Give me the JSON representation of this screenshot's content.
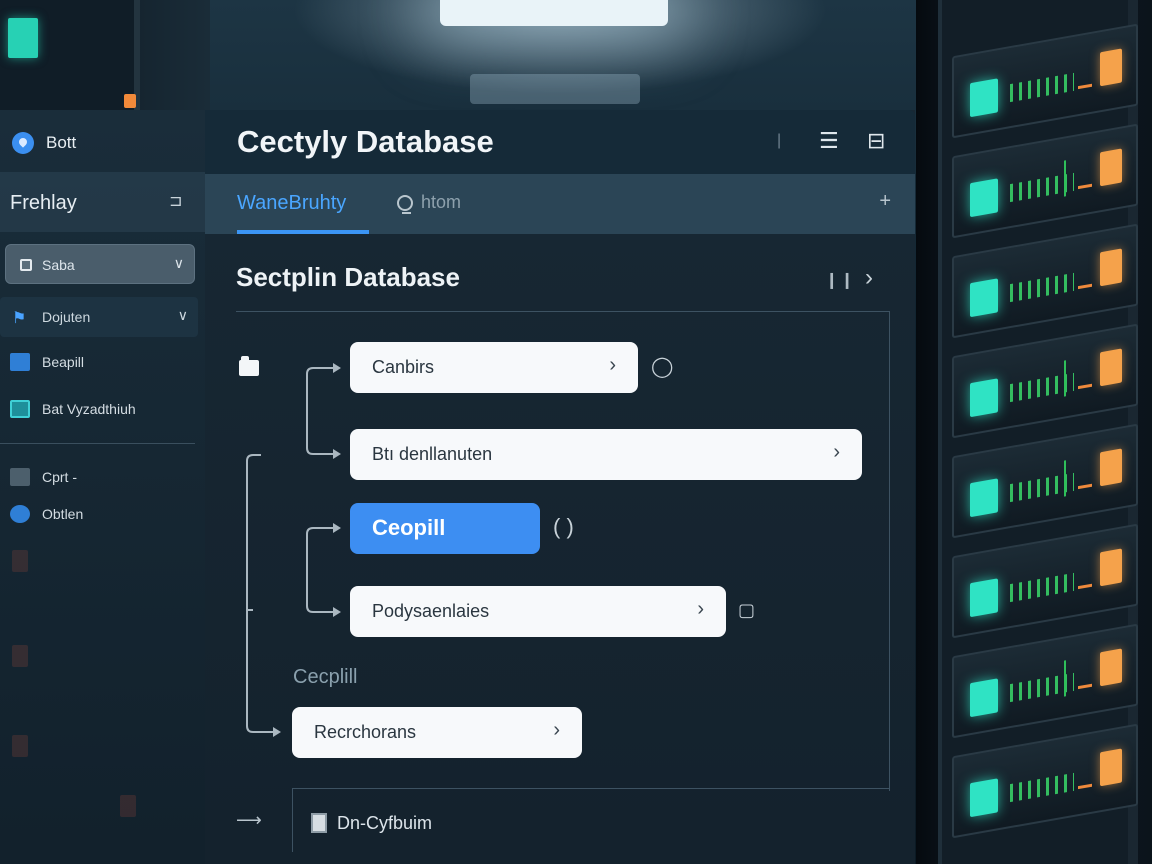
{
  "colors": {
    "accent": "#3d8ef2",
    "tab_active": "#4aa6ff",
    "panel": "#182834",
    "led_teal": "#2fe3c4",
    "led_orange": "#f5a24b"
  },
  "sidebar": {
    "brand": "Bott",
    "header": {
      "title": "Frehlay",
      "icon": "collapse-icon"
    },
    "select": {
      "label": "Saba"
    },
    "group": {
      "label": "Dojuten"
    },
    "items": [
      {
        "label": "Beapill",
        "icon": "blue-square-icon"
      },
      {
        "label": "Bat Vyzadthiuh",
        "icon": "teal-square-icon"
      }
    ],
    "items_secondary": [
      {
        "label": "Cprt -",
        "icon": "grid-icon"
      },
      {
        "label": "Obtlen",
        "icon": "hexagon-icon"
      }
    ]
  },
  "main": {
    "title": "Cectyly Database",
    "tabs": {
      "active": "WaneBruhty",
      "search_placeholder": "htom",
      "plus": "+"
    },
    "section_title": "Sectplin Database",
    "tree": {
      "nodes": [
        {
          "label": "Canbirs"
        },
        {
          "label": "Btı denllanuten"
        },
        {
          "label": "Ceopill",
          "side": "( )"
        },
        {
          "label": "Podysaenlaies"
        },
        {
          "label": "Recrchorans"
        }
      ],
      "group_label": "Cecplill",
      "footer_label": "Dn-Cyfbuim"
    }
  }
}
